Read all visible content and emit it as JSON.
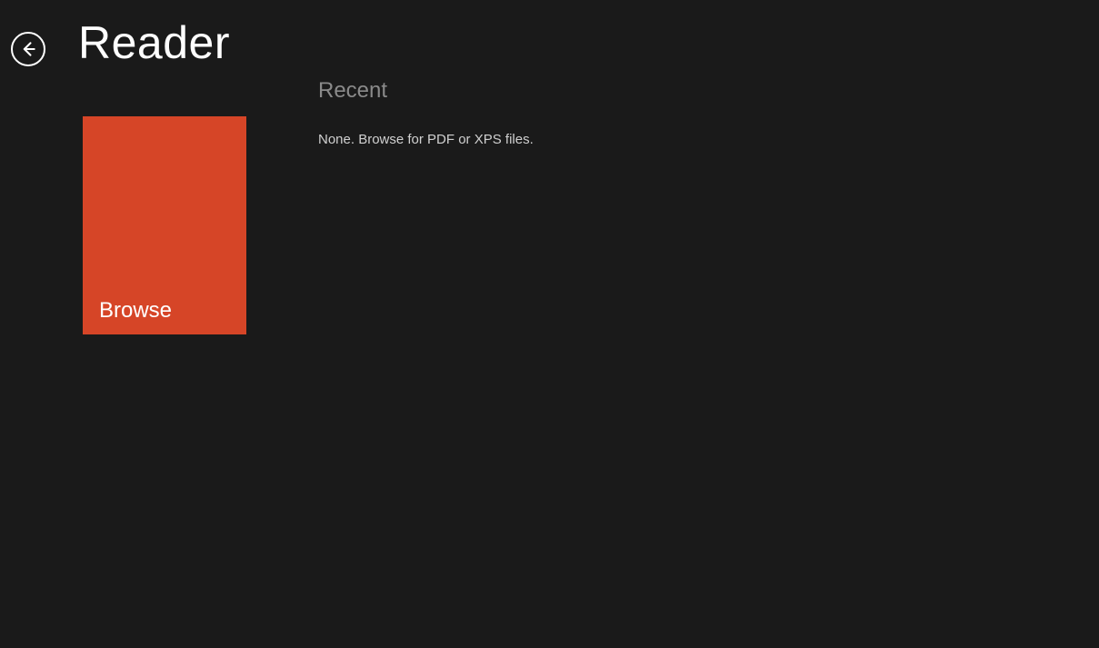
{
  "header": {
    "app_title": "Reader"
  },
  "browse": {
    "label": "Browse",
    "tile_color": "#d64527"
  },
  "recent": {
    "heading": "Recent",
    "empty_text": "None. Browse for PDF or XPS files."
  }
}
